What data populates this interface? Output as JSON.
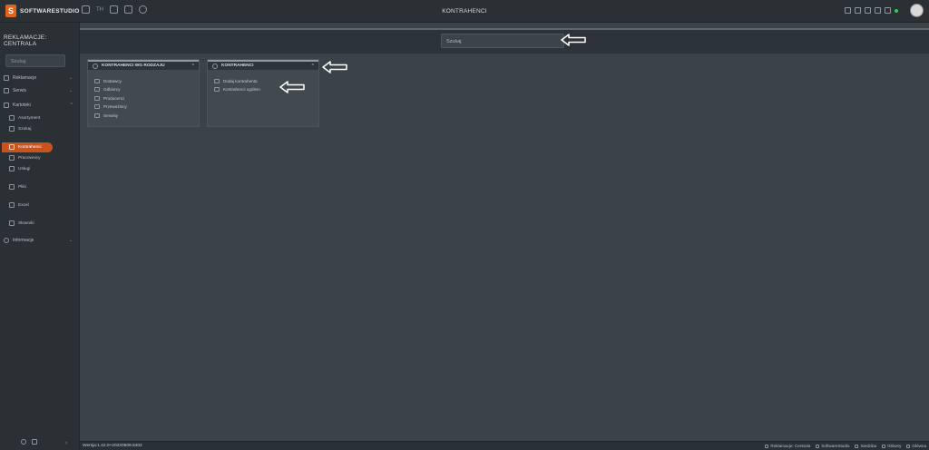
{
  "app": {
    "logo_mark": "S",
    "logo_text": "SOFTWARESTUDIO",
    "page_title": "KONTRAHENCI"
  },
  "topbar": {
    "icons": [
      "users-icon",
      "th-label",
      "org-chart-icon",
      "building-icon",
      "circle-icon"
    ],
    "th_label": "TH"
  },
  "sidebar": {
    "title": "REKLAMACJE: CENTRALA",
    "search_placeholder": "Szukaj",
    "items": [
      {
        "label": "Reklamacje",
        "icon": "document-icon",
        "expandable": true
      },
      {
        "label": "Serwis",
        "icon": "wrench-icon",
        "expandable": true
      },
      {
        "label": "Kartoteki",
        "icon": "folder-icon",
        "expandable": true,
        "expanded": true
      },
      {
        "label": "Informacje",
        "icon": "info-icon",
        "expandable": true
      }
    ],
    "subitems": [
      {
        "label": "Asortyment",
        "icon": "cart-icon"
      },
      {
        "label": "Szukaj",
        "icon": "search-icon"
      },
      {
        "label": "Kontrahenci",
        "icon": "contractor-icon",
        "active": true
      },
      {
        "label": "Pracownicy",
        "icon": "person-icon"
      },
      {
        "label": "Usługi",
        "icon": "clipboard-icon"
      },
      {
        "label": "Pliki",
        "icon": "file-icon"
      },
      {
        "label": "Excel",
        "icon": "excel-icon"
      },
      {
        "label": "Słowniki",
        "icon": "book-icon"
      }
    ],
    "active_color": "#c9531a"
  },
  "main": {
    "search_placeholder": "Szukaj",
    "cards": [
      {
        "title": "KONTRAHENCI WG RODZAJU",
        "items": [
          "Dostawcy",
          "Odbiorcy",
          "Producenci",
          "Przewoźnicy",
          "Serwisy"
        ]
      },
      {
        "title": "KONTRAHENCI",
        "items": [
          "Dodaj kontrahenta",
          "Kontrahenci ogółem"
        ]
      }
    ]
  },
  "statusbar": {
    "version": "Wersja:1.42.0+20220509.6402",
    "items": [
      "Reklamacje: Centrala",
      "SoftwareStudio",
      "Siedziba",
      "Główny",
      "Główna"
    ]
  }
}
